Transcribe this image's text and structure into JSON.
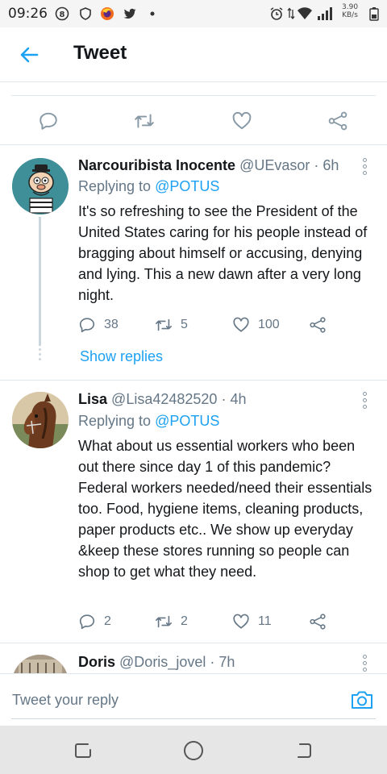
{
  "status_bar": {
    "time": "09:26",
    "net_speed": "3.90",
    "net_unit": "KB/s",
    "icons": [
      "b-circle-icon",
      "shield-icon",
      "firefox-icon",
      "twitter-bird-icon",
      "dot-icon",
      "alarm-icon",
      "data-arrows-icon",
      "wifi-icon",
      "signal-icon",
      "battery-icon"
    ]
  },
  "header": {
    "title": "Tweet",
    "back_icon": "arrow-left-icon"
  },
  "main_actions": [
    "reply-icon",
    "retweet-icon",
    "like-icon",
    "share-icon"
  ],
  "tweets": [
    {
      "name": "Narcouribista Inocente",
      "handle": "@UEvasor",
      "time": "· 6h",
      "replying_label": "Replying to",
      "replying_handle": "@POTUS",
      "text": "It's so refreshing to see the President of the United States caring for his people instead of bragging about himself or accusing, denying and lying. This a new dawn after a very long night.",
      "replies": "38",
      "retweets": "5",
      "likes": "100",
      "show_replies": "Show replies"
    },
    {
      "name": "Lisa",
      "handle": "@Lisa42482520",
      "time": "· 4h",
      "replying_label": "Replying to",
      "replying_handle": "@POTUS",
      "text": "What about us essential workers who been out there since day 1 of this pandemic? Federal workers needed/need their essentials too. Food, hygiene items, cleaning products, paper products etc.. We show up everyday &keep these stores running so people can shop to get what they need.",
      "replies": "2",
      "retweets": "2",
      "likes": "11"
    },
    {
      "name": "Doris",
      "handle": "@Doris_jovel",
      "time": "· 7h"
    }
  ],
  "reply_bar": {
    "placeholder": "Tweet your reply",
    "camera_icon": "camera-icon"
  },
  "nav_bar": [
    "recents-icon",
    "home-circle-icon",
    "back-nav-icon"
  ],
  "colors": {
    "accent": "#1da1f2",
    "secondary_text": "#657786",
    "icon_gray": "#8899a6"
  }
}
